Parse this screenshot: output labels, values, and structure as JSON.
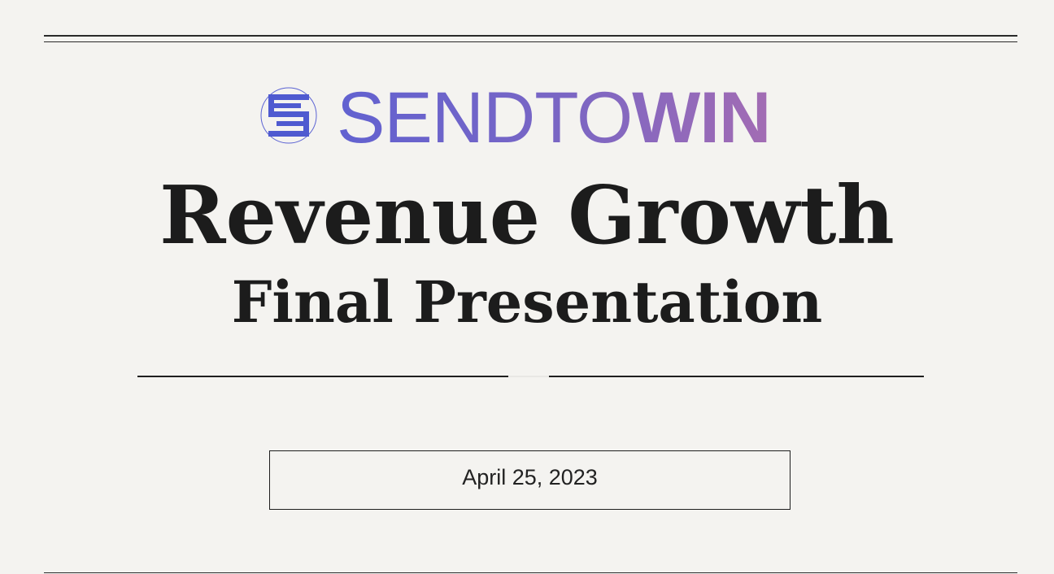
{
  "logo": {
    "text_light": "SENDTO",
    "text_bold": "WIN",
    "icon": "stacked-lines-logo-icon",
    "colors": {
      "start": "#5b63d3",
      "end": "#a86db2"
    }
  },
  "title": "Revenue Growth",
  "subtitle": "Final Presentation",
  "date": "April 25, 2023"
}
